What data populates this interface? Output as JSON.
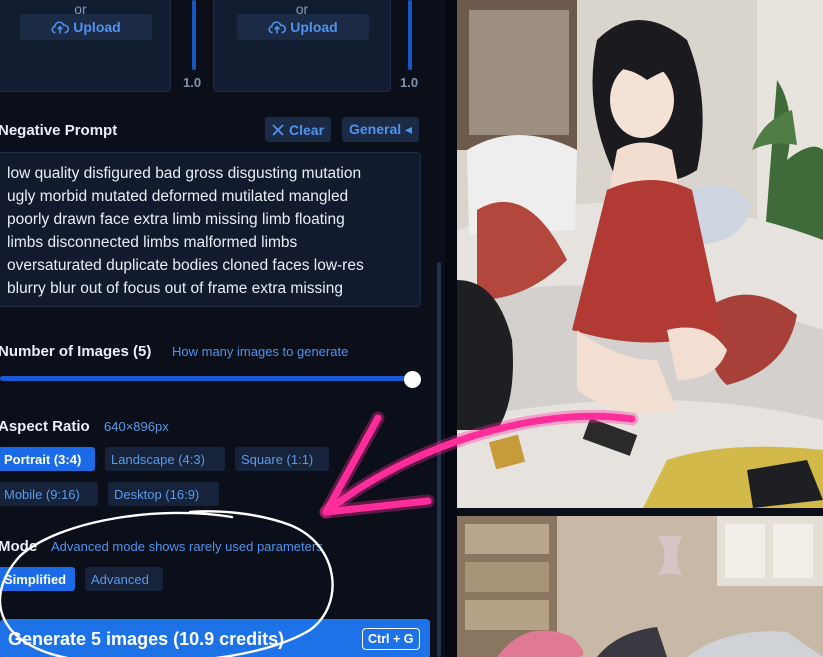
{
  "upload": {
    "or_left": "or",
    "or_right": "or",
    "button_left": "Upload",
    "button_right": "Upload",
    "weight_left": "1.0",
    "weight_right": "1.0"
  },
  "negative_prompt": {
    "label": "Negative Prompt",
    "clear_label": "Clear",
    "preset_label": "General ◂",
    "lines": [
      "low quality disfigured bad gross disgusting mutation",
      "ugly morbid mutated deformed mutilated mangled",
      "poorly drawn face extra limb missing limb floating",
      "limbs disconnected limbs malformed limbs",
      "oversaturated duplicate bodies cloned faces low-res",
      "blurry blur out of focus out of frame extra missing"
    ]
  },
  "num_images": {
    "label": "Number of Images (5)",
    "hint": "How many images to generate",
    "value": 5,
    "fraction": 1.0
  },
  "aspect_ratio": {
    "label": "Aspect Ratio",
    "size": "640×896px",
    "options": [
      "Portrait (3:4)",
      "Landscape (4:3)",
      "Square (1:1)",
      "Mobile (9:16)",
      "Desktop (16:9)"
    ],
    "selected": "Portrait (3:4)"
  },
  "mode": {
    "label": "Mode",
    "hint": "Advanced mode shows rarely used parameters",
    "options": [
      "Simplified",
      "Advanced"
    ],
    "selected": "Simplified"
  },
  "generate": {
    "label": "Generate 5 images (10.9 credits)",
    "shortcut": "Ctrl + G"
  },
  "icons": [
    "cloud-upload-icon",
    "close-icon"
  ],
  "colors": {
    "accent": "#1e72e8",
    "link": "#4f93ec",
    "background": "#0b0f1a",
    "annotation": "#ff2d9b"
  }
}
